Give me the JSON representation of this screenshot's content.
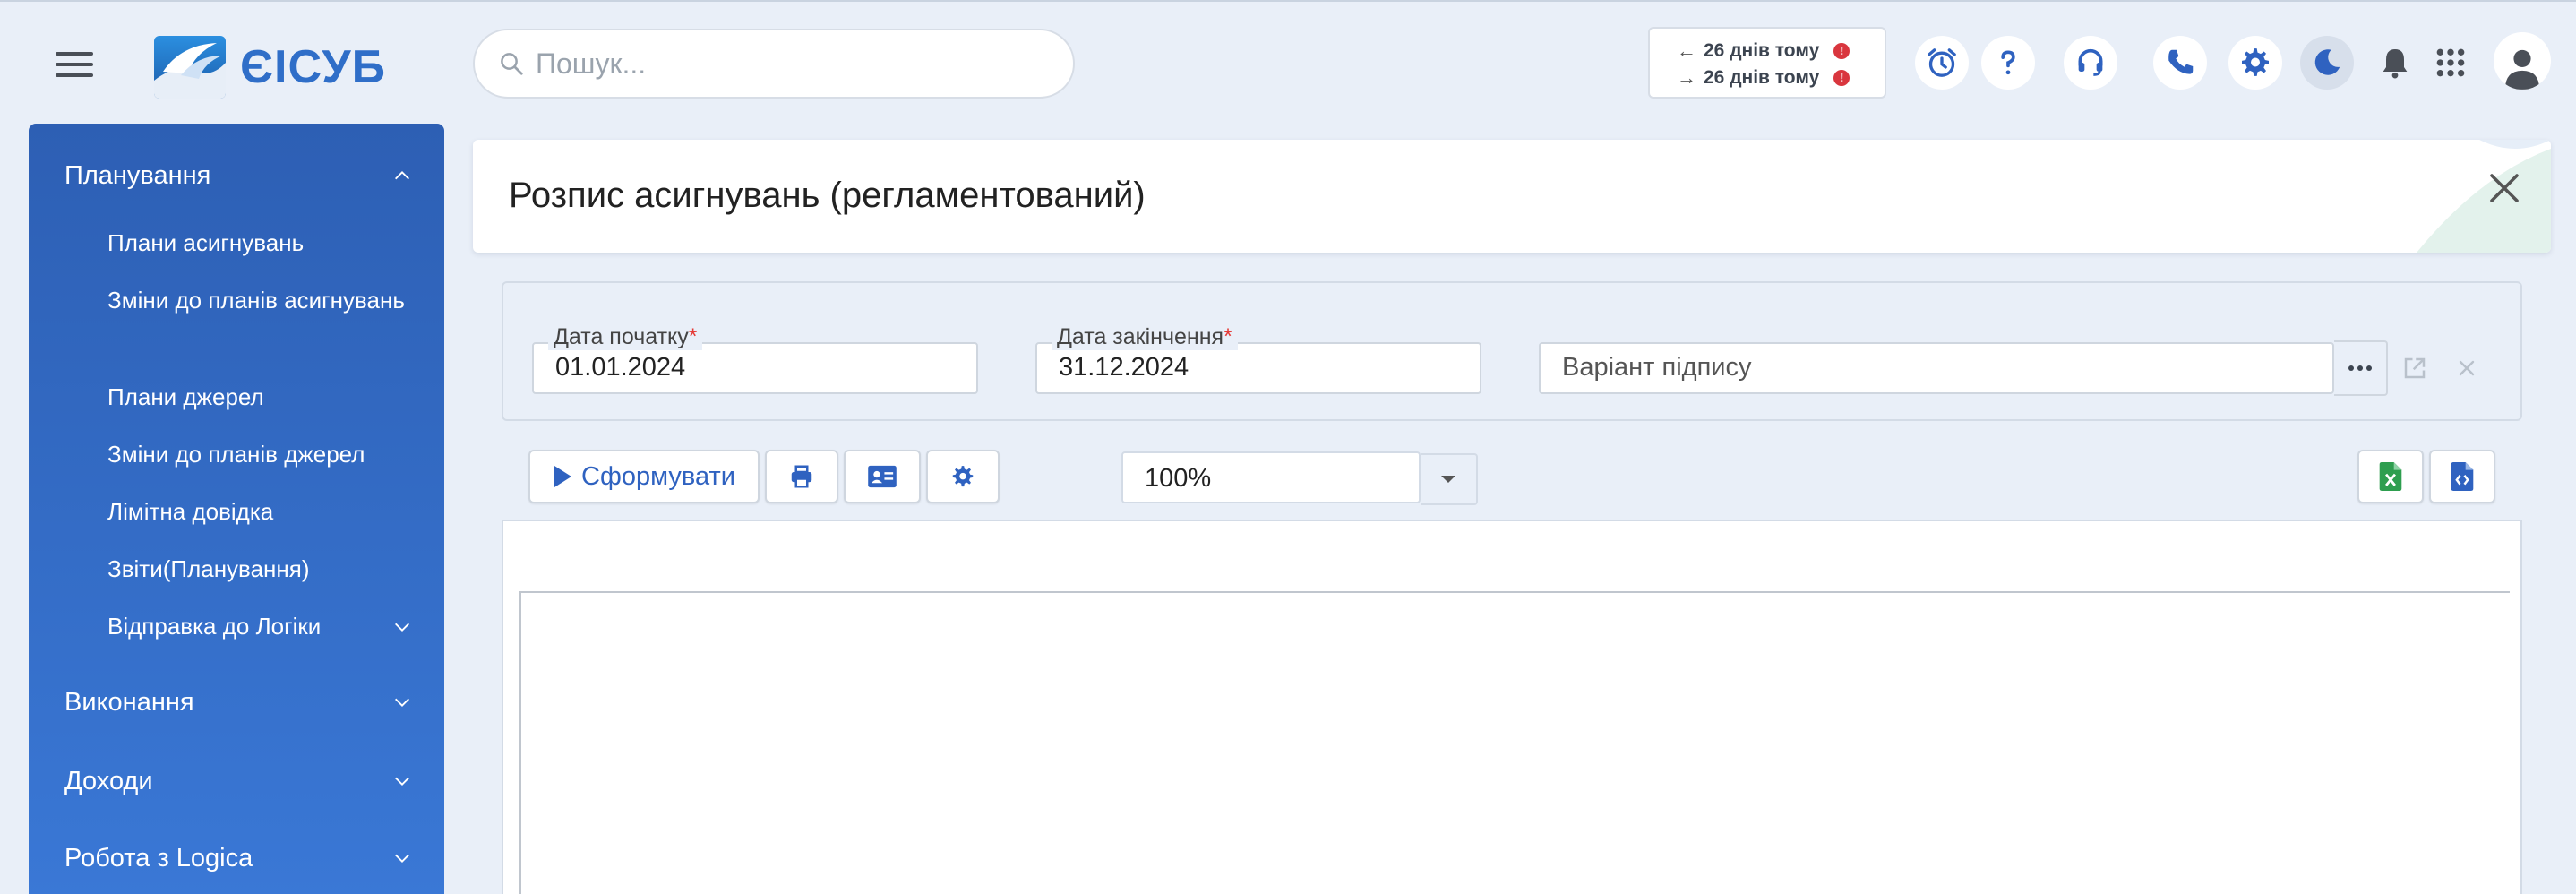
{
  "app": {
    "logo_text": "ЄІСУБ"
  },
  "search": {
    "placeholder": "Пошук..."
  },
  "sync": {
    "outgoing": "26 днів тому",
    "incoming": "26 днів тому",
    "alert_mark": "!"
  },
  "header_icons": [
    "alarm-clock-icon",
    "help-icon",
    "headset-icon",
    "phone-icon",
    "gear-icon",
    "moon-icon",
    "bell-icon",
    "apps-grid-icon",
    "user-icon"
  ],
  "sidebar": {
    "sections": [
      {
        "label": "Планування",
        "expanded": true,
        "items": [
          "Плани асигнувань",
          "Зміни до планів асигнувань",
          "Плани джерел",
          "Зміни до планів джерел",
          "Лімітна довідка",
          "Звіти(Планування)",
          "Відправка до Логіки"
        ]
      },
      {
        "label": "Виконання",
        "expanded": false
      },
      {
        "label": "Доходи",
        "expanded": false
      },
      {
        "label": "Робота з Logica",
        "expanded": false
      }
    ]
  },
  "page": {
    "title": "Розпис асигнувань (регламентований)"
  },
  "params": {
    "start_date": {
      "label": "Дата початку",
      "required_mark": "*",
      "value": "01.01.2024"
    },
    "end_date": {
      "label": "Дата закінчення",
      "required_mark": "*",
      "value": "31.12.2024"
    },
    "signature": {
      "placeholder": "Варіант підпису"
    }
  },
  "toolbar": {
    "generate_label": "Сформувати",
    "zoom_value": "100%"
  },
  "colors": {
    "accent": "#2f62c0",
    "sidebar_top": "#2d5fb4",
    "sidebar_bottom": "#3a78d6",
    "page_bg": "#e9eff8",
    "alert": "#d9363e",
    "excel": "#2e9e4f"
  }
}
